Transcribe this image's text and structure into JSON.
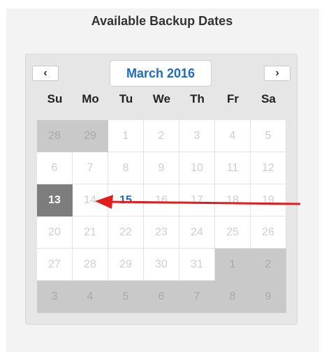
{
  "page": {
    "title": "Available Backup Dates"
  },
  "calendar": {
    "prev_icon": "chevron-left-icon",
    "next_icon": "chevron-right-icon",
    "prev_label": "‹",
    "next_label": "›",
    "month_label": "March 2016",
    "weekdays": [
      "Su",
      "Mo",
      "Tu",
      "We",
      "Th",
      "Fr",
      "Sa"
    ],
    "weeks": [
      [
        {
          "d": "28",
          "s": "other"
        },
        {
          "d": "29",
          "s": "other"
        },
        {
          "d": "1",
          "s": "disabled"
        },
        {
          "d": "2",
          "s": "disabled"
        },
        {
          "d": "3",
          "s": "disabled"
        },
        {
          "d": "4",
          "s": "disabled"
        },
        {
          "d": "5",
          "s": "disabled"
        }
      ],
      [
        {
          "d": "6",
          "s": "disabled"
        },
        {
          "d": "7",
          "s": "disabled"
        },
        {
          "d": "8",
          "s": "disabled"
        },
        {
          "d": "9",
          "s": "disabled"
        },
        {
          "d": "10",
          "s": "disabled"
        },
        {
          "d": "11",
          "s": "disabled"
        },
        {
          "d": "12",
          "s": "disabled"
        }
      ],
      [
        {
          "d": "13",
          "s": "selected"
        },
        {
          "d": "14",
          "s": "disabled"
        },
        {
          "d": "15",
          "s": "available"
        },
        {
          "d": "16",
          "s": "disabled"
        },
        {
          "d": "17",
          "s": "disabled"
        },
        {
          "d": "18",
          "s": "disabled"
        },
        {
          "d": "19",
          "s": "disabled"
        }
      ],
      [
        {
          "d": "20",
          "s": "disabled"
        },
        {
          "d": "21",
          "s": "disabled"
        },
        {
          "d": "22",
          "s": "disabled"
        },
        {
          "d": "23",
          "s": "disabled"
        },
        {
          "d": "24",
          "s": "disabled"
        },
        {
          "d": "25",
          "s": "disabled"
        },
        {
          "d": "26",
          "s": "disabled"
        }
      ],
      [
        {
          "d": "27",
          "s": "disabled"
        },
        {
          "d": "28",
          "s": "disabled"
        },
        {
          "d": "29",
          "s": "disabled"
        },
        {
          "d": "30",
          "s": "disabled"
        },
        {
          "d": "31",
          "s": "disabled"
        },
        {
          "d": "1",
          "s": "other"
        },
        {
          "d": "2",
          "s": "other"
        }
      ],
      [
        {
          "d": "3",
          "s": "other"
        },
        {
          "d": "4",
          "s": "other"
        },
        {
          "d": "5",
          "s": "other"
        },
        {
          "d": "6",
          "s": "other"
        },
        {
          "d": "7",
          "s": "other"
        },
        {
          "d": "8",
          "s": "other"
        },
        {
          "d": "9",
          "s": "other"
        }
      ]
    ]
  },
  "annotation": {
    "icon": "red-arrow-icon",
    "color": "#e31b1b"
  },
  "colors": {
    "accent": "#1a6cc4",
    "selected": "#7d7d7d",
    "other_month": "#c9c9c9"
  }
}
